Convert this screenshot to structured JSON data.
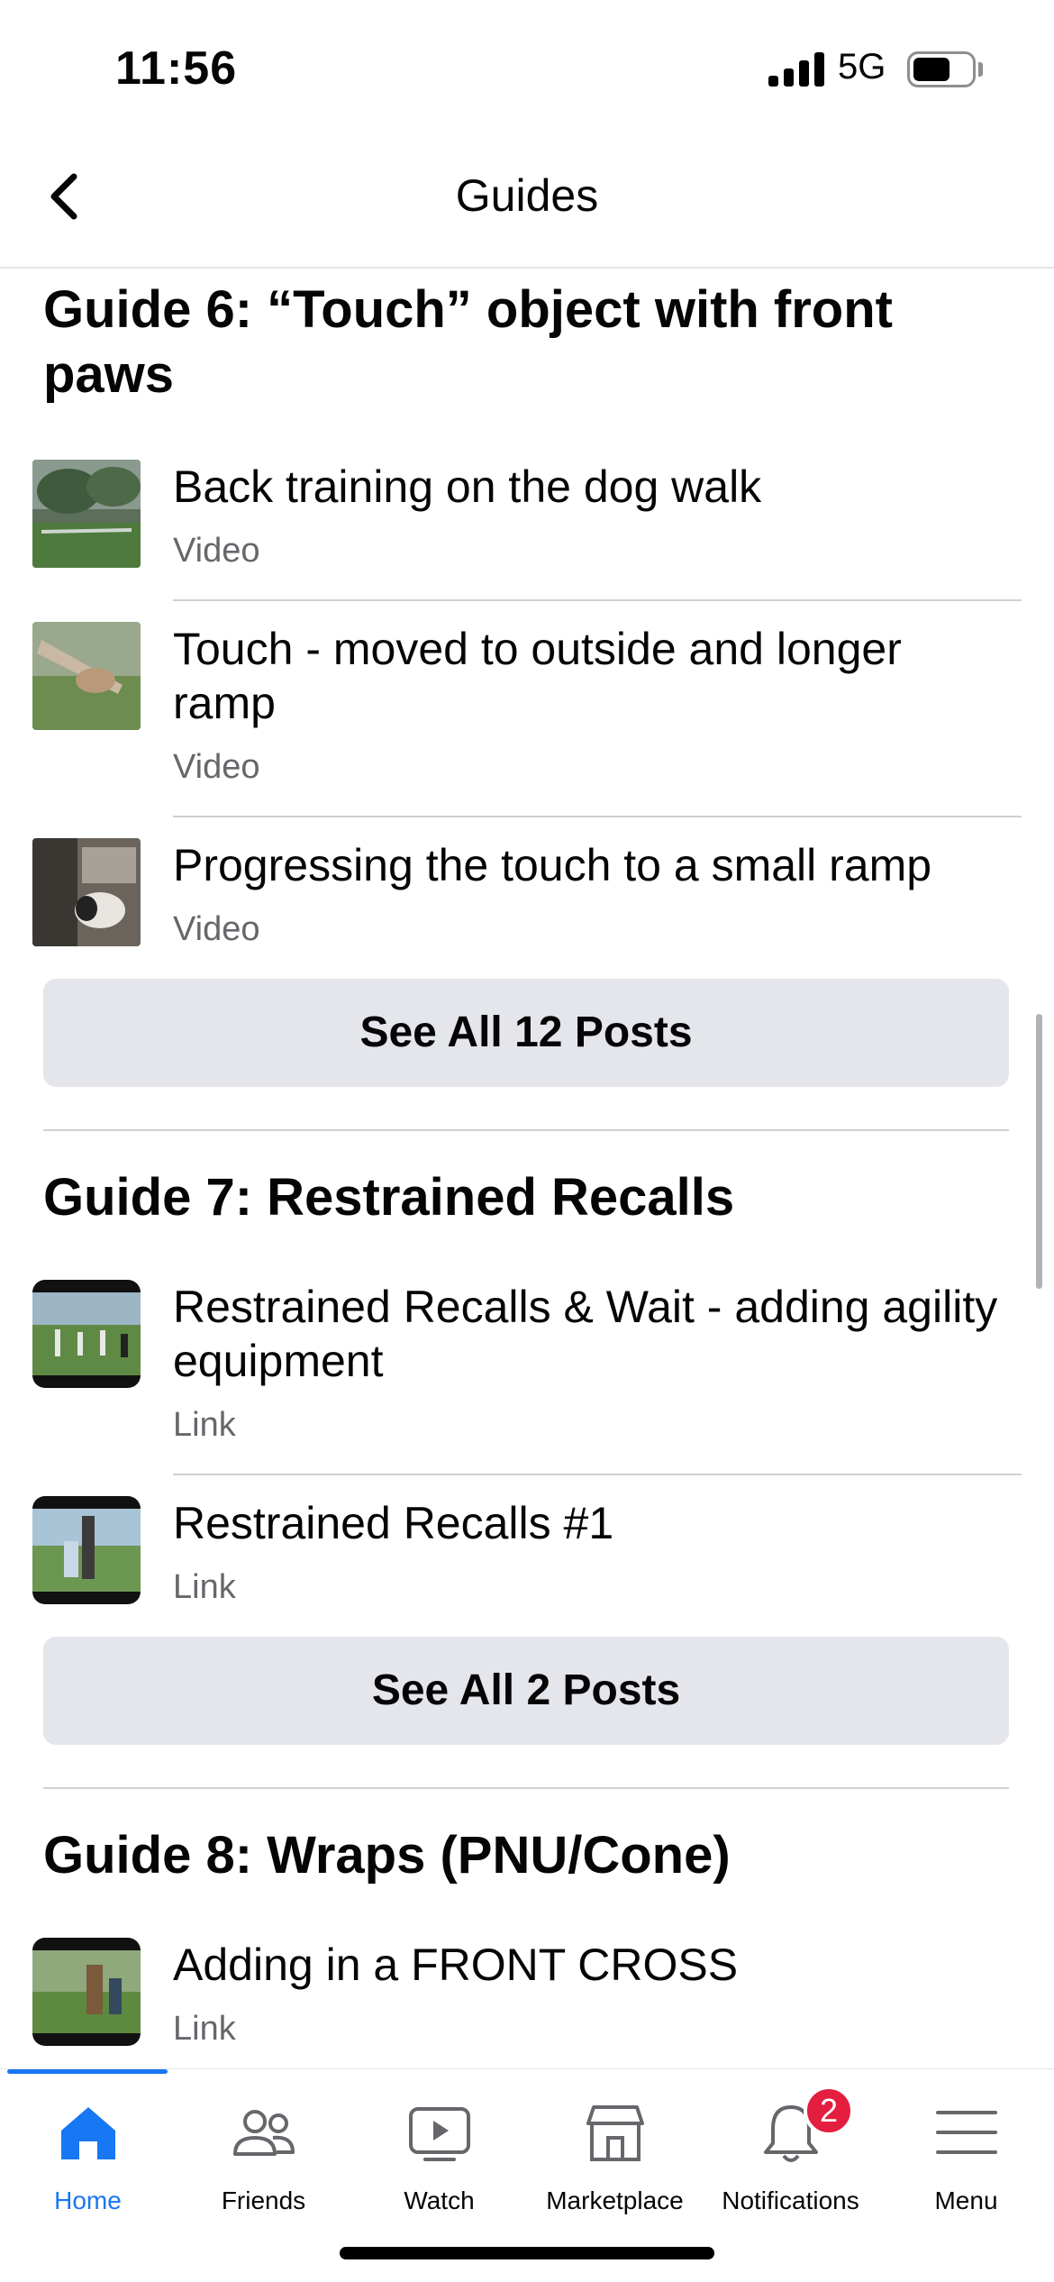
{
  "status_bar": {
    "time": "11:56",
    "network": "5G"
  },
  "header": {
    "title": "Guides"
  },
  "guides": [
    {
      "title": "Guide 6: “Touch” object with front paws",
      "items": [
        {
          "title": "Back training on the dog walk",
          "type": "Video"
        },
        {
          "title": "Touch - moved to outside and longer ramp",
          "type": "Video"
        },
        {
          "title": "Progressing the touch to a small ramp",
          "type": "Video"
        }
      ],
      "see_all": "See All 12 Posts"
    },
    {
      "title": "Guide 7: Restrained Recalls",
      "items": [
        {
          "title": "Restrained Recalls & Wait - adding agility equipment",
          "type": "Link"
        },
        {
          "title": "Restrained Recalls #1",
          "type": "Link"
        }
      ],
      "see_all": "See All 2 Posts"
    },
    {
      "title": "Guide 8: Wraps (PNU/Cone)",
      "items": [
        {
          "title": "Adding in a FRONT CROSS",
          "type": "Link"
        }
      ]
    }
  ],
  "tabbar": {
    "tabs": [
      {
        "label": "Home",
        "icon": "home-icon",
        "active": true
      },
      {
        "label": "Friends",
        "icon": "friends-icon"
      },
      {
        "label": "Watch",
        "icon": "watch-icon"
      },
      {
        "label": "Marketplace",
        "icon": "marketplace-icon"
      },
      {
        "label": "Notifications",
        "icon": "bell-icon",
        "badge": "2"
      },
      {
        "label": "Menu",
        "icon": "menu-icon"
      }
    ]
  },
  "colors": {
    "accent": "#1877f2",
    "badge": "#e41e3f",
    "secondary_text": "#65676b",
    "button_bg": "#e4e6eb"
  }
}
